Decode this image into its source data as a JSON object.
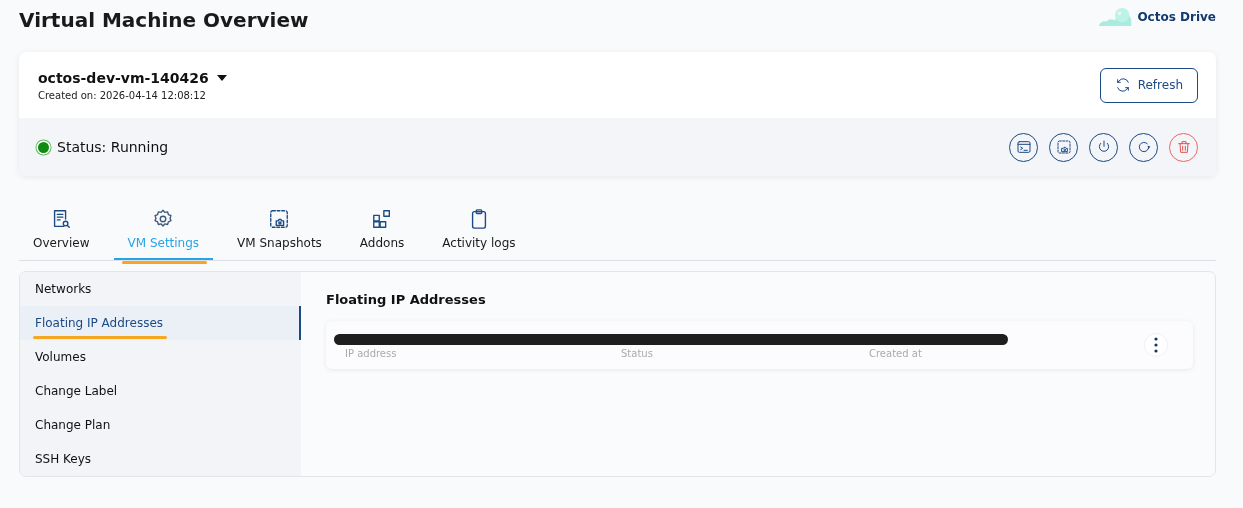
{
  "page": {
    "title": "Virtual Machine Overview",
    "brand": "Octos Drive"
  },
  "vm": {
    "name": "octos-dev-vm-140426",
    "created": "Created on: 2026-04-14 12:08:12",
    "refresh": "Refresh",
    "status": "Status: Running",
    "running": true
  },
  "actions": [
    {
      "kind": "console"
    },
    {
      "kind": "snapshot"
    },
    {
      "kind": "power"
    },
    {
      "kind": "restart"
    },
    {
      "kind": "delete"
    }
  ],
  "tabs": [
    {
      "label": "Overview",
      "kind": "overview",
      "selected": false
    },
    {
      "label": "VM Settings",
      "kind": "settings",
      "selected": true
    },
    {
      "label": "VM Snapshots",
      "kind": "snapshot",
      "selected": false
    },
    {
      "label": "Addons",
      "kind": "addons",
      "selected": false
    },
    {
      "label": "Activity logs",
      "kind": "logs",
      "selected": false
    }
  ],
  "sidebar": {
    "items": [
      {
        "label": "Networks",
        "selected": false
      },
      {
        "label": "Floating IP Addresses",
        "selected": true
      },
      {
        "label": "Volumes",
        "selected": false
      },
      {
        "label": "Change Label",
        "selected": false
      },
      {
        "label": "Change Plan",
        "selected": false
      },
      {
        "label": "SSH Keys",
        "selected": false
      }
    ]
  },
  "content": {
    "title": "Floating IP Addresses",
    "rows": [
      {
        "redacted": true,
        "labels": [
          "IP address",
          "Status",
          "Created at"
        ]
      }
    ]
  }
}
